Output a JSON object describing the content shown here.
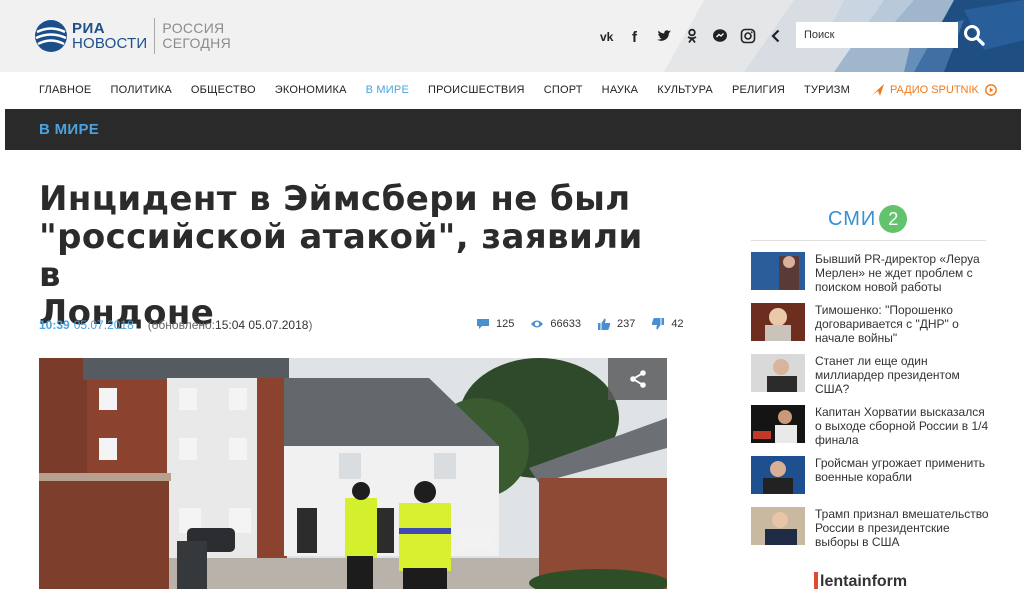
{
  "header": {
    "logo_ria_line1": "РИА",
    "logo_ria_line2": "НОВОСТИ",
    "logo_rs_line1": "РОССИЯ",
    "logo_rs_line2": "СЕГОДНЯ",
    "social_icons": [
      "vk-icon",
      "facebook-icon",
      "twitter-icon",
      "odnoklassniki-icon",
      "messenger-icon",
      "instagram-icon",
      "chevron-left-icon"
    ],
    "search_placeholder": "Поиск"
  },
  "nav": {
    "items": [
      "ГЛАВНОЕ",
      "ПОЛИТИКА",
      "ОБЩЕСТВО",
      "ЭКОНОМИКА",
      "В МИРЕ",
      "ПРОИСШЕСТВИЯ",
      "СПОРТ",
      "НАУКА",
      "КУЛЬТУРА",
      "РЕЛИГИЯ",
      "ТУРИЗМ"
    ],
    "active": "В МИРЕ",
    "radio": "РАДИО SPUTNIK"
  },
  "section": {
    "title": "В МИРЕ"
  },
  "article": {
    "title_line1": "Инцидент в Эймсбери не был",
    "title_line2": "\"российской атакой\", заявили в",
    "title_line3": "Лондоне",
    "time": "10:39",
    "date": "05.07.2018",
    "updated_prefix": "(обновлено: ",
    "updated_value": "15:04 05.07.2018",
    "updated_suffix": ")",
    "comments": "125",
    "views": "66633",
    "likes": "237",
    "dislikes": "42"
  },
  "sidebar": {
    "smi_text": "СМИ",
    "smi_num": "2",
    "news": [
      {
        "text": "Бывший PR-директор «Леруа Мерлен» не ждет проблем с поиском новой работы"
      },
      {
        "text": "Тимошенко: \"Порошенко договаривается с \"ДНР\" о начале войны\""
      },
      {
        "text": "Станет ли еще один миллиардер президентом США?"
      },
      {
        "text": "Капитан Хорватии высказался о выходе сборной России в 1/4 финала"
      },
      {
        "text": "Гройсман угрожает применить военные корабли"
      },
      {
        "text": "Трамп признал вмешательство России в президентские выборы в США"
      }
    ],
    "lentainform": "lentainform"
  },
  "colors": {
    "accent": "#4aa3df",
    "section_bg": "#2a2a2a",
    "radio": "#ef7a1b",
    "smi_green": "#62c36c"
  }
}
